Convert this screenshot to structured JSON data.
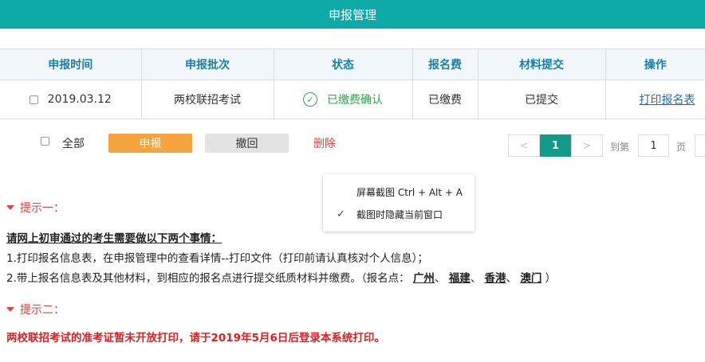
{
  "header": {
    "title": "申报管理"
  },
  "table": {
    "columns": [
      "申报时间",
      "申报批次",
      "状态",
      "报名费",
      "材料提交",
      "操作"
    ],
    "row": {
      "date": "2019.03.12",
      "batch": "两校联招考试",
      "status": "已缴费确认",
      "fee": "已缴费",
      "materials": "已提交",
      "action": "打印报名表"
    }
  },
  "actions": {
    "select_all": "全部",
    "submit": "申报",
    "withdraw": "撤回",
    "delete": "删除"
  },
  "pager": {
    "prev": "<",
    "current": "1",
    "next": ">",
    "goto_label": "到第",
    "goto_value": "1",
    "page_unit": "页"
  },
  "context_menu": {
    "item1": "屏幕截图 Ctrl + Alt + A",
    "item2": "截图时隐藏当前窗口"
  },
  "tips": {
    "tip1_title": "提示一：",
    "tip1_heading": "请网上初审通过的考生需要做以下两个事情：",
    "tip1_line1": "1.打印报名信息表，在申报管理中的查看详情--打印文件（打印前请认真核对个人信息）；",
    "tip1_line2_prefix": "2.带上报名信息表及其他材料，到相应的报名点进行提交纸质材料并缴费。（报名点：",
    "points": [
      "广州",
      "福建",
      "香港",
      "澳门"
    ],
    "sep": "、",
    "tip1_line2_suffix": "）",
    "tip2_title": "提示二：",
    "tip2_text": "两校联招考试的准考证暂未开放打印，请于2019年5月6日后登录本系统打印。"
  },
  "colors": {
    "header_bg": "#0eaaa8",
    "submit_bg": "#f5a33c",
    "pager_active": "#139b8a",
    "tip_red": "#e3413b"
  }
}
